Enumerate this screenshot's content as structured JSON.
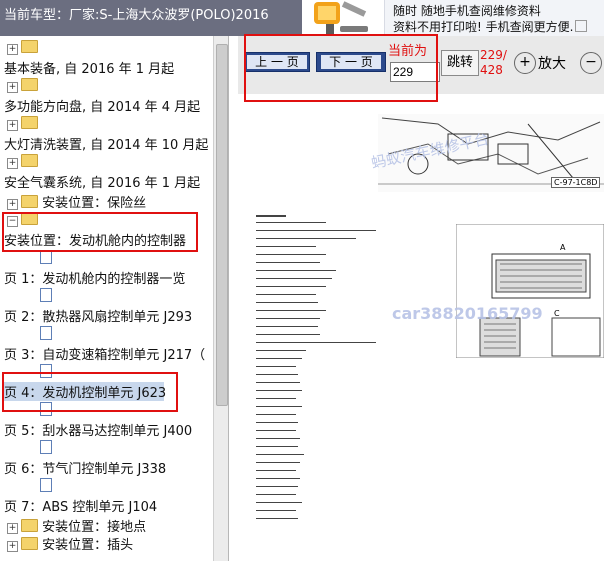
{
  "header": {
    "title": "当前车型：厂家:S-上海大众波罗(POLO)2016"
  },
  "promo": {
    "line1": "随时 随地手机查阅维修资料",
    "line2": "资料不用打印啦! 手机查阅更方便."
  },
  "tree": {
    "items": [
      {
        "label": "",
        "kind": "folder-plus"
      },
      {
        "label": "基本装备, 自 2016 年 1 月起"
      },
      {
        "label": "",
        "kind": "folder-plus"
      },
      {
        "label": "多功能方向盘, 自 2014 年 4 月起"
      },
      {
        "label": "",
        "kind": "folder-plus"
      },
      {
        "label": "大灯清洗装置, 自 2014 年 10 月起"
      },
      {
        "label": "",
        "kind": "folder-plus"
      },
      {
        "label": "安全气囊系统, 自 2016 年 1 月起"
      },
      {
        "label": "安装位置：保险丝",
        "kind": "folder-plus-indent"
      },
      {
        "label": "",
        "kind": "folder-minus"
      },
      {
        "label": "安装位置：发动机舱内的控制器"
      },
      {
        "label": "页 1：发动机舱内的控制器一览"
      },
      {
        "label": "页 2：散热器风扇控制单元 J293"
      },
      {
        "label": "页 3：自动变速箱控制单元 J217（"
      },
      {
        "label": "页 4：发动机控制单元 J623"
      },
      {
        "label": "页 5：刮水器马达控制单元 J400"
      },
      {
        "label": "页 6：节气门控制单元 J338"
      },
      {
        "label": "页 7：ABS 控制单元 J104"
      },
      {
        "label": "安装位置：接地点",
        "kind": "folder-plus-indent"
      },
      {
        "label": "安装位置：插头",
        "kind": "folder-plus-indent"
      }
    ]
  },
  "viewer": {
    "prev_label": "上 一 页",
    "next_label": "下 一 页",
    "current_label": "当前为",
    "page_value": "229",
    "jump_label": "跳转",
    "page_current": "229/",
    "page_total": "428",
    "zoom_in_label": "放大",
    "watermark1": "蚂蚁汽车维修平台",
    "watermark2": "car38820165799",
    "figure_caption": "C-97-1C8D"
  },
  "colors": {
    "header_bg": "#6b6e80",
    "highlight": "#e01010",
    "nav_blue": "#2c4a8c",
    "selection": "#c8d7ec"
  }
}
